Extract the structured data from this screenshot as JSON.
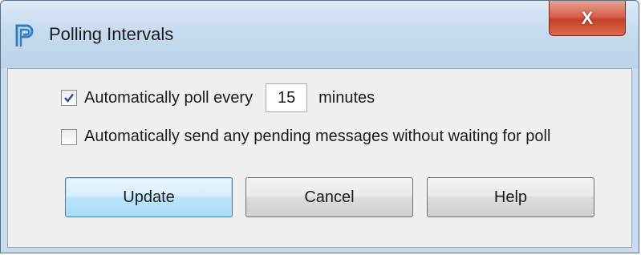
{
  "window": {
    "title": "Polling Intervals",
    "icon": "polling-app-icon",
    "close_icon": "close-x-icon",
    "close_glyph": "X"
  },
  "options": {
    "auto_poll": {
      "checked": true,
      "label_before": "Automatically poll every",
      "minutes_value": "15",
      "label_after": "minutes"
    },
    "auto_send": {
      "checked": false,
      "label": "Automatically send any pending messages without waiting for poll"
    }
  },
  "buttons": {
    "update": "Update",
    "cancel": "Cancel",
    "help": "Help"
  },
  "colors": {
    "accent": "#2f7fc1",
    "close_red": "#c5412a",
    "default_button_border": "#3c7fb1"
  }
}
